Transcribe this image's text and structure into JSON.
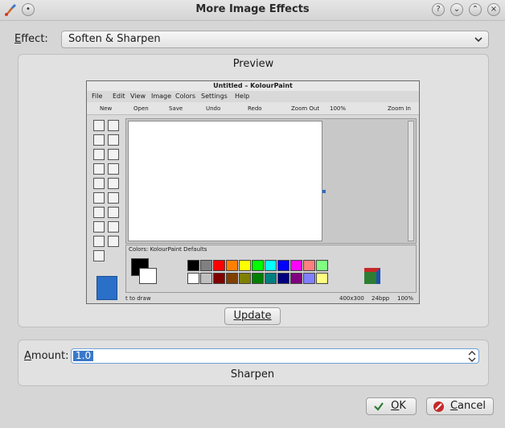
{
  "window": {
    "title": "More Image Effects",
    "app_icon": "kolourpaint-brush-icon"
  },
  "effect": {
    "label_u": "E",
    "label_rest": "ffect:",
    "value": "Soften & Sharpen"
  },
  "preview": {
    "title": "Preview",
    "update_label": "Update",
    "screenshot": {
      "title": "Untitled – KolourPaint",
      "menu": [
        "File",
        "Edit",
        "View",
        "Image",
        "Colors",
        "Settings",
        "Help"
      ],
      "toolbar": [
        "New",
        "Open",
        "Save",
        "Undo",
        "Redo",
        "Zoom Out",
        "100%",
        "Zoom In"
      ],
      "colors_label": "Colors: KolourPaint Defaults",
      "status_left": "t to draw",
      "status_size": "400x300",
      "status_bpp": "24bpp",
      "status_zoom": "100%"
    }
  },
  "amount": {
    "label_u": "A",
    "label_rest": "mount:",
    "value": "1.0",
    "mode": "Sharpen"
  },
  "buttons": {
    "ok_label_u": "O",
    "ok_label_rest": "K",
    "cancel_label_u": "C",
    "cancel_label_rest": "ancel"
  },
  "colors": {
    "accent": "#3a78c8",
    "ok_icon": "#2e7d32",
    "cancel_icon": "#c62828"
  },
  "palette_top": [
    "#000000",
    "#808080",
    "#ff0000",
    "#ff8000",
    "#ffff00",
    "#00ff00",
    "#00ffff",
    "#0000ff",
    "#ff00ff",
    "#ff8080",
    "#80ff80"
  ],
  "palette_bottom": [
    "#ffffff",
    "#c0c0c0",
    "#800000",
    "#804000",
    "#808000",
    "#008000",
    "#008080",
    "#000080",
    "#800080",
    "#8080ff",
    "#ffff80"
  ]
}
